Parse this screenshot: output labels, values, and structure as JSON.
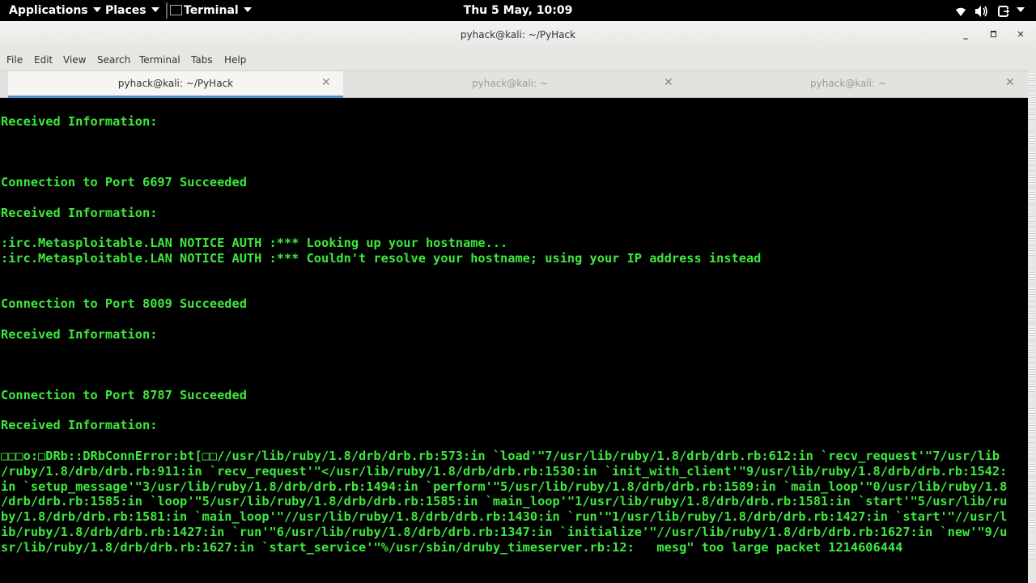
{
  "topbar": {
    "applications": "Applications",
    "places": "Places",
    "terminal": "Terminal",
    "clock": "Thu  5 May, 10:09",
    "icons": [
      "wifi-icon",
      "volume-icon",
      "power-icon"
    ]
  },
  "window": {
    "title": "pyhack@kali: ~/PyHack",
    "menu": [
      "File",
      "Edit",
      "View",
      "Search",
      "Terminal",
      "Tabs",
      "Help"
    ],
    "tabs": [
      {
        "label": "pyhack@kali: ~/PyHack",
        "active": true
      },
      {
        "label": "pyhack@kali: ~",
        "active": false
      },
      {
        "label": "pyhack@kali: ~",
        "active": false
      }
    ]
  },
  "terminal": {
    "lines": [
      "Received Information:",
      "Connection to Port 6697 Succeeded",
      "Received Information:",
      ":irc.Metasploitable.LAN NOTICE AUTH :*** Looking up your hostname...",
      ":irc.Metasploitable.LAN NOTICE AUTH :*** Couldn't resolve your hostname; using your IP address instead",
      "Connection to Port 8009 Succeeded",
      "Received Information:",
      "Connection to Port 8787 Succeeded",
      "Received Information:",
      "□□□o:□DRb::DRbConnError:bt[□□//usr/lib/ruby/1.8/drb/drb.rb:573:in `load'\"7/usr/lib/ruby/1.8/drb/drb.rb:612:in `recv_request'\"7/usr/lib",
      "/ruby/1.8/drb/drb.rb:911:in `recv_request'\"</usr/lib/ruby/1.8/drb/drb.rb:1530:in `init_with_client'\"9/usr/lib/ruby/1.8/drb/drb.rb:1542:",
      "in `setup_message'\"3/usr/lib/ruby/1.8/drb/drb.rb:1494:in `perform'\"5/usr/lib/ruby/1.8/drb/drb.rb:1589:in `main_loop'\"0/usr/lib/ruby/1.8",
      "/drb/drb.rb:1585:in `loop'\"5/usr/lib/ruby/1.8/drb/drb.rb:1585:in `main_loop'\"1/usr/lib/ruby/1.8/drb/drb.rb:1581:in `start'\"5/usr/lib/ru",
      "by/1.8/drb/drb.rb:1581:in `main_loop'\"//usr/lib/ruby/1.8/drb/drb.rb:1430:in `run'\"1/usr/lib/ruby/1.8/drb/drb.rb:1427:in `start'\"//usr/l",
      "ib/ruby/1.8/drb/drb.rb:1427:in `run'\"6/usr/lib/ruby/1.8/drb/drb.rb:1347:in `initialize'\"//usr/lib/ruby/1.8/drb/drb.rb:1627:in `new'\"9/u",
      "sr/lib/ruby/1.8/drb/drb.rb:1627:in `start_service'\"%/usr/sbin/druby_timeserver.rb:12:   mesg\" too large packet 1214606444"
    ]
  }
}
